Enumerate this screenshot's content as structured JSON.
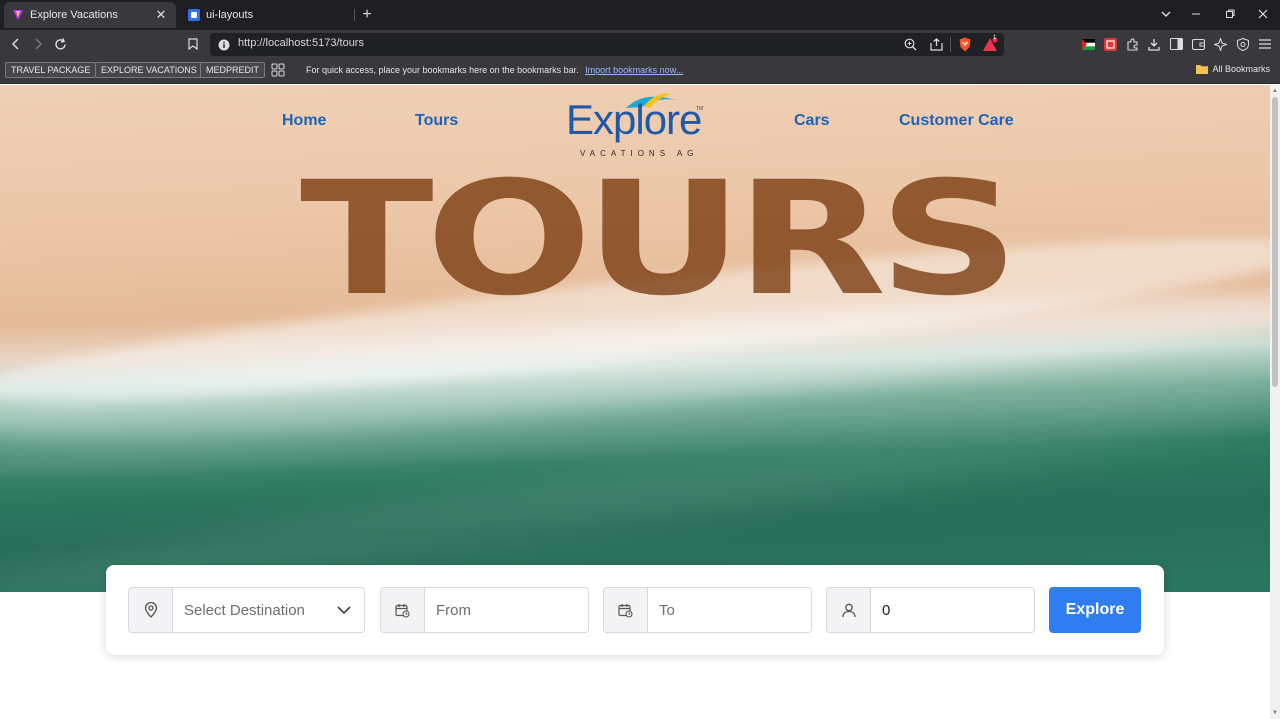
{
  "browser": {
    "tabs": [
      {
        "title": "Explore Vacations",
        "active": true,
        "close": "✕"
      },
      {
        "title": "ui-layouts",
        "active": false
      }
    ],
    "new_tab_icon": "plus-icon",
    "url": "http://localhost:5173/tours",
    "bookmarks": [
      "TRAVEL PACKAGE",
      "EXPLORE VACATIONS",
      "MEDPREDIT"
    ],
    "bookmarks_hint": "For quick access, place your bookmarks here on the bookmarks bar.",
    "bookmarks_import": "Import bookmarks now...",
    "all_bookmarks": "All Bookmarks",
    "shield_badge": "1"
  },
  "nav": {
    "links_left": [
      "Home",
      "Tours"
    ],
    "links_right": [
      "Cars",
      "Customer Care"
    ],
    "logo_word": "Explore",
    "logo_sub": "VACATIONS AG",
    "logo_tm": "TM"
  },
  "hero": {
    "title": "TOURS"
  },
  "search": {
    "destination": "Select Destination",
    "from_placeholder": "From",
    "to_placeholder": "To",
    "guests": "0",
    "button": "Explore"
  },
  "colors": {
    "nav_link": "#1f63b8",
    "accent_button": "#2f7df0",
    "hero_title": "#783a0e"
  }
}
